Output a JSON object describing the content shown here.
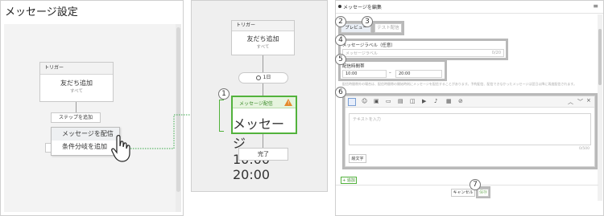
{
  "panel1": {
    "title": "メッセージ設定",
    "trigger_node": {
      "header": "トリガー",
      "title": "友だち追加",
      "sub": "すべて"
    },
    "add_step_label": "ステップを追加",
    "menu_items": [
      "メッセージを配信",
      "条件分岐を追加"
    ]
  },
  "panel2": {
    "trigger_node": {
      "header": "トリガー",
      "title": "友だち追加",
      "sub": "すべて"
    },
    "delay_label": "1日",
    "message_node": {
      "header": "メッセージ配信",
      "title": "メッセージ",
      "sub": "10:00 - 20:00"
    },
    "done_label": "完了",
    "warning_glyph": "!"
  },
  "panel3": {
    "title": "メッセージを編集",
    "menu_glyph": "≡",
    "tabs": [
      "プレビュー",
      "テスト配信"
    ],
    "label_field": {
      "label": "メッセージラベル（任意）",
      "placeholder": "メッセージラベル",
      "count": "0/20"
    },
    "time_field": {
      "label": "配信時間帯",
      "start": "10:00",
      "sep": "–",
      "end": "20:00"
    },
    "note": "配信時間帯外の場合は、配信時間帯の開始時刻にメッセージを配信することがあります。予約配信、配信できなかったメッセージは翌日以降に再度配信されます。",
    "editor": {
      "placeholder": "テキストを入力",
      "count": "0/500",
      "emoji_button": "絵文字"
    },
    "toolbar_icons": [
      "speech-bubble",
      "smile",
      "image",
      "video",
      "card",
      "coupon",
      "play",
      "mic",
      "gallery",
      "link"
    ],
    "add_label": "+ 追加",
    "cancel_label": "キャンセル",
    "save_label": "保存"
  },
  "callouts": [
    "1",
    "2",
    "3",
    "4",
    "5",
    "6",
    "7"
  ]
}
